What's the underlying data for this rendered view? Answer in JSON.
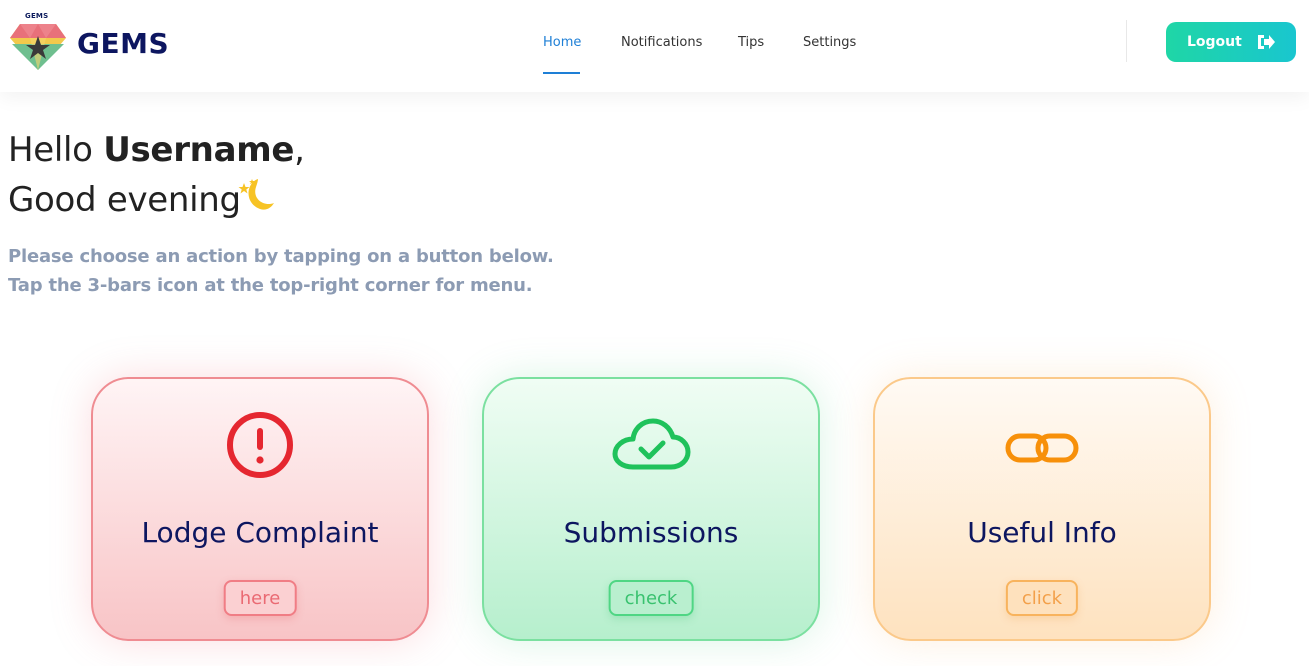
{
  "header": {
    "logo_tag": "GEMS",
    "brand": "GEMS",
    "nav": [
      {
        "label": "Home",
        "active": true
      },
      {
        "label": "Notifications",
        "active": false
      },
      {
        "label": "Tips",
        "active": false
      },
      {
        "label": "Settings",
        "active": false
      }
    ],
    "logout_label": "Logout",
    "logout_icon": "sign-out-icon"
  },
  "greeting": {
    "hello_prefix": "Hello ",
    "username": "Username",
    "hello_suffix": ",",
    "time_of_day": "Good evening",
    "moon_icon": "crescent-moon-icon"
  },
  "instructions": [
    "Please choose an action by tapping on a button below.",
    "Tap the 3-bars icon at the top-right corner for menu."
  ],
  "cards": [
    {
      "title": "Lodge Complaint",
      "button": "here",
      "icon": "exclamation-circle-icon",
      "color": "#e52730"
    },
    {
      "title": "Submissions",
      "button": "check",
      "icon": "cloud-check-icon",
      "color": "#1fc25b"
    },
    {
      "title": "Useful Info",
      "button": "click",
      "icon": "link-icon",
      "color": "#f7900a"
    }
  ],
  "colors": {
    "accent": "#1e7fd6",
    "brand_navy": "#0d1660",
    "logout_gradient_start": "#1fd6a6",
    "logout_gradient_end": "#19c6cf",
    "muted_text": "#8c9bb3"
  }
}
